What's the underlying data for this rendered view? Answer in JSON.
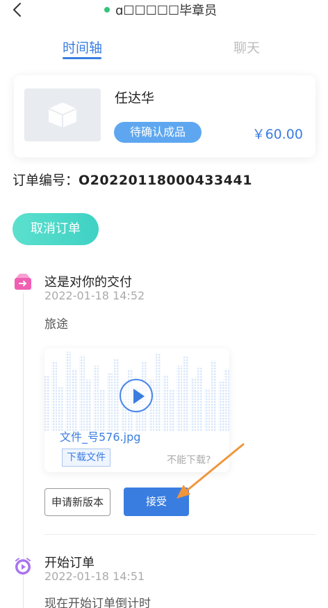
{
  "header": {
    "title": "ɑ☐☐☐☐☐毕章员",
    "back_icon": "chevron-left-icon",
    "online_color": "#33c37c"
  },
  "tabs": [
    {
      "label": "时间轴",
      "active": true
    },
    {
      "label": "聊天",
      "active": false
    }
  ],
  "product": {
    "name": "任达华",
    "status": "待确认成品",
    "price": "￥60.00",
    "thumb_icon": "box-icon"
  },
  "order": {
    "label": "订单编号：",
    "number": "O20220118000433441"
  },
  "cancel_button": "取消订单",
  "timeline": [
    {
      "icon": "delivery-box-icon",
      "title": "这是对你的交付",
      "time": "2022-01-18 14:52",
      "desc": "旅途",
      "file": {
        "name": "文件_号576.jpg",
        "download_label": "下载文件",
        "cant_download": "不能下载?"
      },
      "actions": {
        "new_version": "申请新版本",
        "accept": "接受"
      }
    },
    {
      "icon": "alarm-clock-icon",
      "title": "开始订单",
      "time": "2022-01-18 14:51",
      "desc": "现在开始订单倒计时"
    }
  ],
  "colors": {
    "accent": "#3a7de0",
    "teal": "#3fd1c4",
    "annotation_arrow": "#f0953a"
  }
}
